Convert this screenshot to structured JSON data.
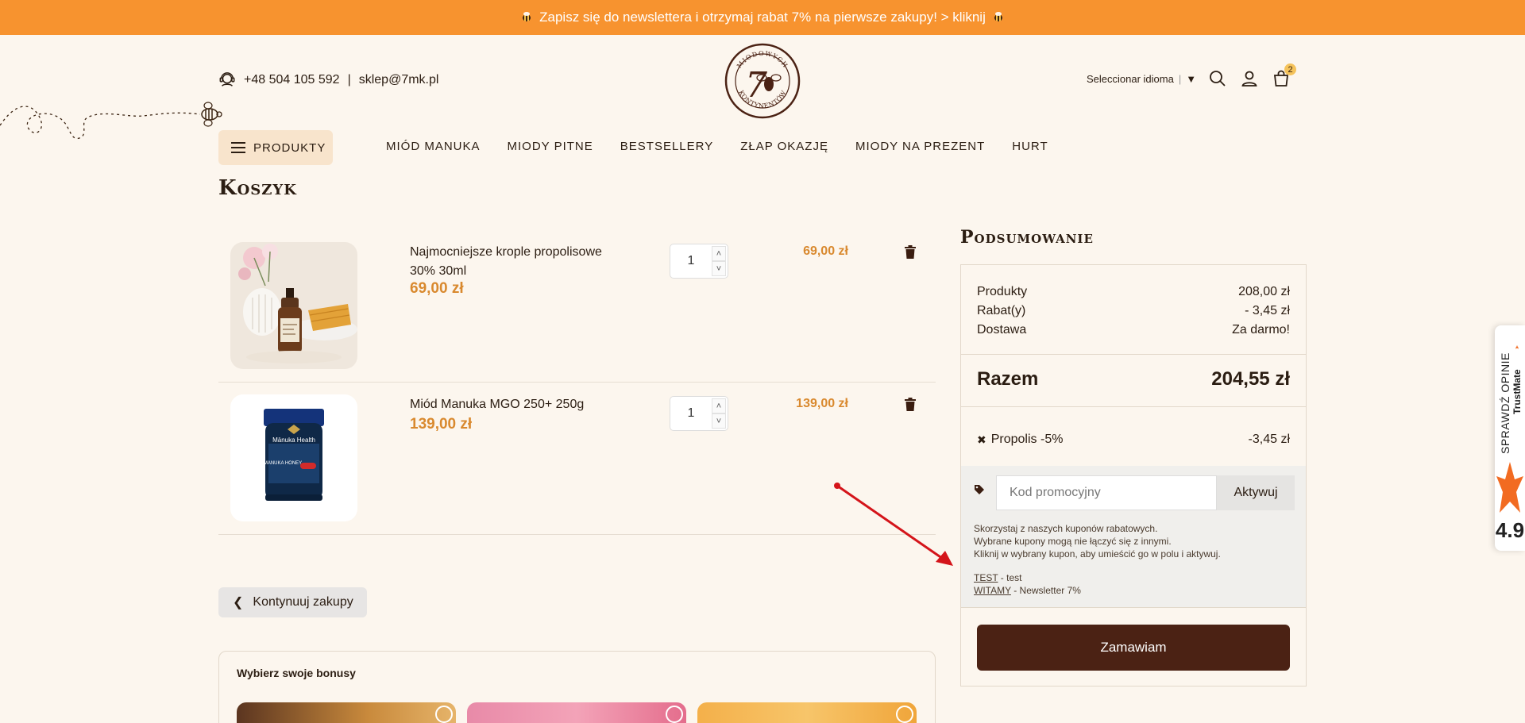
{
  "banner": {
    "text": "Zapisz się do newslettera i otrzymaj rabat 7% na pierwsze zakupy! > kliknij"
  },
  "contact": {
    "phone": "+48 504 105 592",
    "separator": "|",
    "email": "sklep@7mk.pl"
  },
  "logo": {
    "digit": "7",
    "ring_text_top": "MIODOWYCH",
    "ring_text_bottom": "KONTYNENTÓW"
  },
  "header": {
    "language_label": "Seleccionar idioma",
    "language_separator": "|",
    "cart_count": "2"
  },
  "nav": {
    "products_label": "PRODUKTY",
    "items": [
      "MIÓD MANUKA",
      "MIODY PITNE",
      "BESTSELLERY",
      "ZŁAP OKAZJĘ",
      "MIODY NA PREZENT",
      "HURT"
    ]
  },
  "page_title": "Koszyk",
  "cart": {
    "items": [
      {
        "name": "Najmocniejsze krople propolisowe 30% 30ml",
        "price": "69,00 zł",
        "quantity": "1",
        "line_total": "69,00 zł"
      },
      {
        "name": "Miód Manuka MGO 250+ 250g",
        "price": "139,00 zł",
        "quantity": "1",
        "line_total": "139,00 zł"
      }
    ],
    "product_labels": {
      "jar_brand": "Mānuka Health",
      "jar_type": "MANUKA HONEY"
    }
  },
  "continue_label": "Kontynuuj zakupy",
  "bonus": {
    "title": "Wybierz swoje bonusy"
  },
  "summary": {
    "title": "Podsumowanie",
    "lines": [
      {
        "label": "Produkty",
        "value": "208,00 zł"
      },
      {
        "label": "Rabat(y)",
        "value": "- 3,45 zł"
      },
      {
        "label": "Dostawa",
        "value": "Za darmo!"
      }
    ],
    "total_label": "Razem",
    "total_value": "204,55 zł",
    "discount_name": "Propolis -5%",
    "discount_value": "-3,45 zł",
    "coupon_placeholder": "Kod promocyjny",
    "coupon_button": "Aktywuj",
    "help_lines": [
      "Skorzystaj z naszych kuponów rabatowych.",
      "Wybrane kupony mogą nie łączyć się z innymi.",
      "Kliknij w wybrany kupon, aby umieścić go w polu i aktywuj."
    ],
    "coupons": [
      {
        "code": "TEST",
        "description": " - test"
      },
      {
        "code": "WITAMY",
        "description": " - Newsletter 7%"
      }
    ],
    "order_button": "Zamawiam"
  },
  "trustmate": {
    "label": "SPRAWDŹ OPINIE",
    "brand": "TrustMate",
    "rating": "4.9"
  },
  "colors": {
    "banner": "#f7932f",
    "accent": "#d9892e",
    "dark_brown": "#4b2214",
    "background": "#fcf6ee"
  }
}
